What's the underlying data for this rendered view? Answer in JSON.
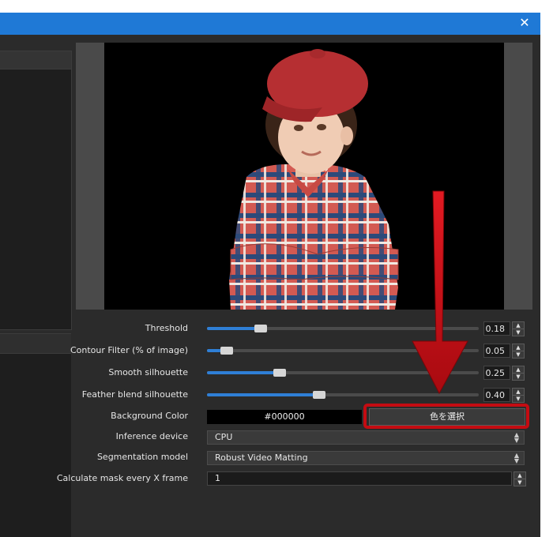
{
  "window": {
    "close_glyph": "✕"
  },
  "settings": {
    "threshold": {
      "label": "Threshold",
      "value": "0.18",
      "fraction": 0.18
    },
    "contour": {
      "label": "Contour Filter (% of image)",
      "value": "0.05",
      "fraction": 0.05
    },
    "smooth": {
      "label": "Smooth silhouette",
      "value": "0.25",
      "fraction": 0.25
    },
    "feather": {
      "label": "Feather blend silhouette",
      "value": "0.40",
      "fraction": 0.4
    },
    "background_color": {
      "label": "Background Color",
      "value": "#000000",
      "button": "色を選択"
    },
    "inference_device": {
      "label": "Inference device",
      "value": "CPU"
    },
    "segmentation_model": {
      "label": "Segmentation model",
      "value": "Robust Video Matting"
    },
    "mask_every": {
      "label": "Calculate mask every X frame",
      "value": "1"
    }
  },
  "colors": {
    "accent": "#1f79d6",
    "slider_fill": "#2f7fd6",
    "highlight": "#c40c12",
    "panel_bg": "#2b2b2b"
  },
  "icons": {
    "close": "close-icon",
    "spin_up": "chevron-up-icon",
    "spin_down": "chevron-down-icon",
    "dropdown": "updown-caret-icon"
  }
}
